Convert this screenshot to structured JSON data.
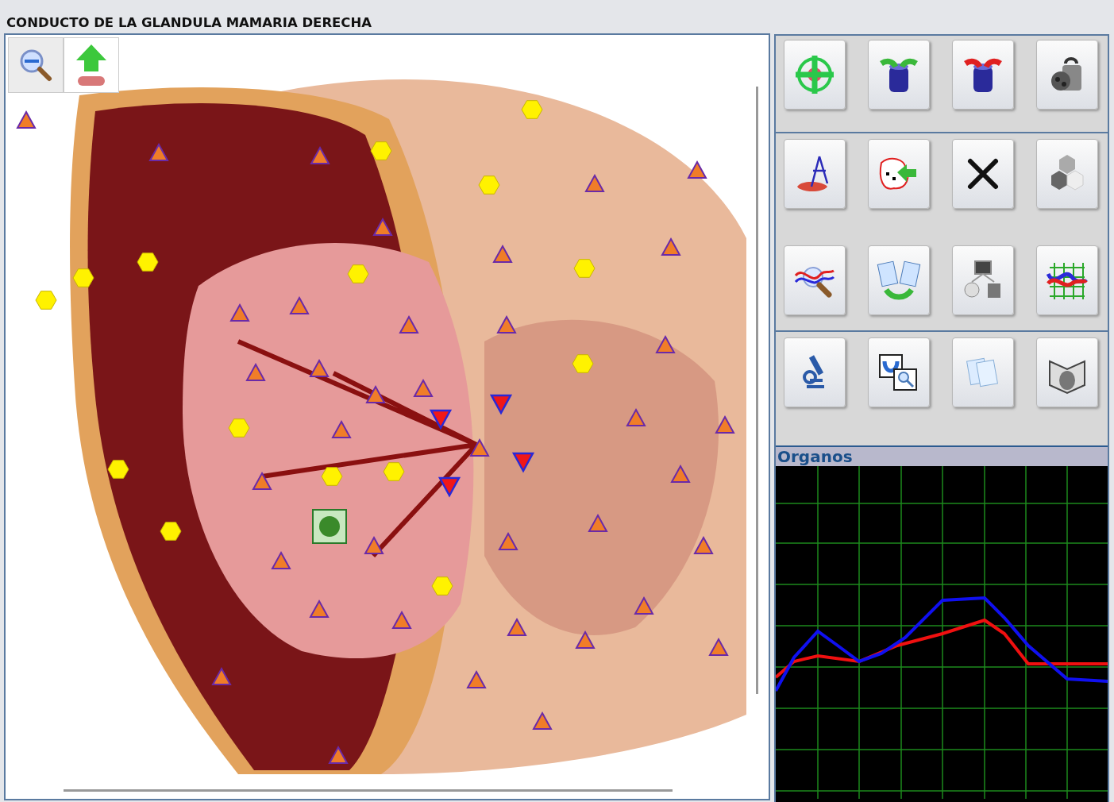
{
  "window": {
    "title": "CONDUCTO DE LA GLANDULA MAMARIA DERECHA"
  },
  "organs_panel": {
    "title": "Organos"
  }
}
